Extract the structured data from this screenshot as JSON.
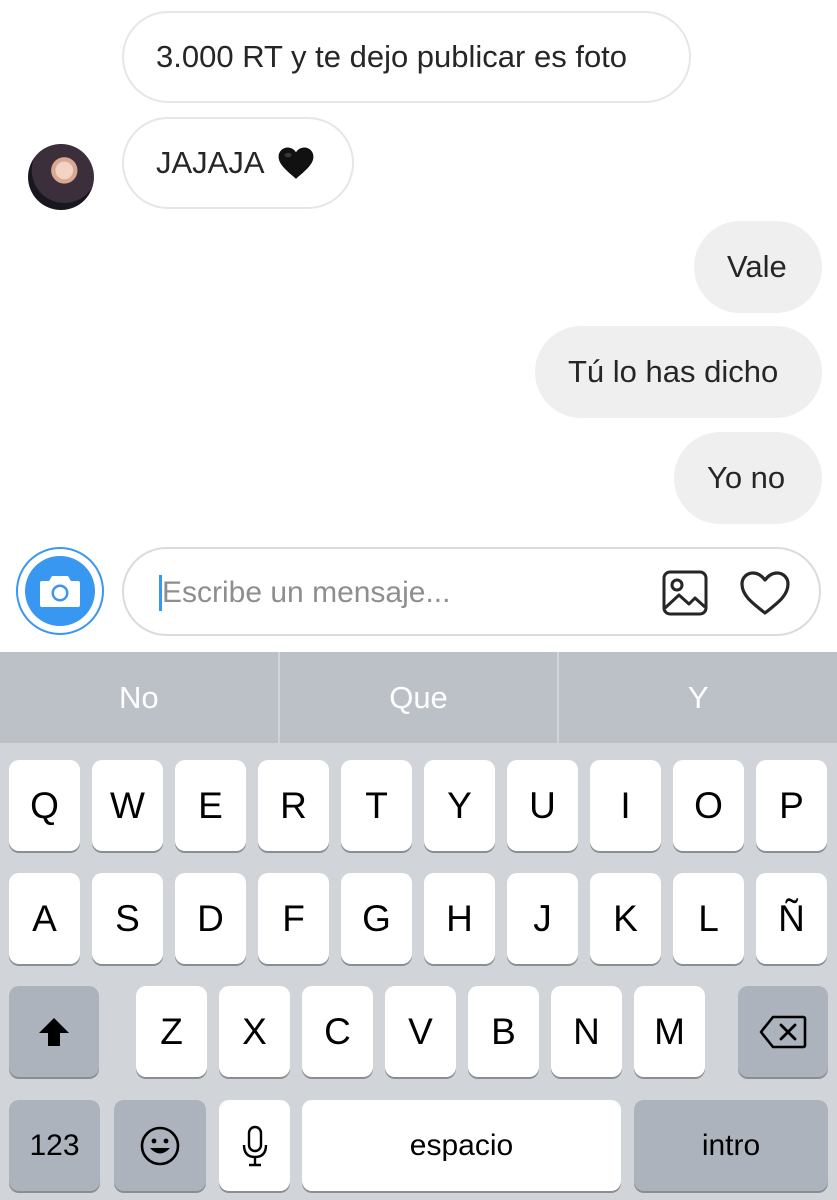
{
  "messages": [
    {
      "text": "3.000 RT y te dejo publicar es foto",
      "direction": "in"
    },
    {
      "text": "JAJAJA",
      "direction": "in",
      "emoji": "black-heart"
    },
    {
      "text": "Vale",
      "direction": "out"
    },
    {
      "text": "Tú lo has dicho",
      "direction": "out"
    },
    {
      "text": "Yo no",
      "direction": "out"
    }
  ],
  "composer": {
    "placeholder": "Escribe un mensaje...",
    "value": ""
  },
  "icons": {
    "camera": "camera-icon",
    "gallery": "gallery-icon",
    "like": "heart-icon",
    "shift": "shift-icon",
    "delete": "delete-icon",
    "emoji": "emoji-icon",
    "mic": "microphone-icon"
  },
  "keyboard": {
    "suggestions": [
      "No",
      "Que",
      "Y"
    ],
    "row1": [
      "Q",
      "W",
      "E",
      "R",
      "T",
      "Y",
      "U",
      "I",
      "O",
      "P"
    ],
    "row2": [
      "A",
      "S",
      "D",
      "F",
      "G",
      "H",
      "J",
      "K",
      "L",
      "Ñ"
    ],
    "row3": [
      "Z",
      "X",
      "C",
      "V",
      "B",
      "N",
      "M"
    ],
    "numbers_label": "123",
    "space_label": "espacio",
    "return_label": "intro"
  },
  "colors": {
    "accent": "#3897f0",
    "incoming_border": "#e6e6e6",
    "outgoing_bg": "#efefef",
    "keyboard_bg": "#d1d4d9",
    "suggestion_bg": "#bcc1c8"
  }
}
